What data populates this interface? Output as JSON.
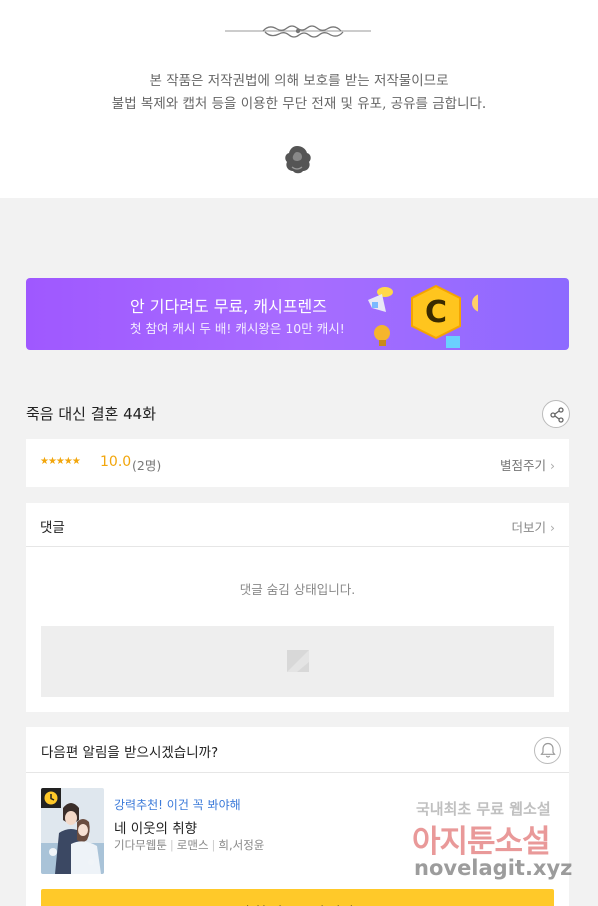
{
  "copyright": {
    "line1": "본 작품은 저작권법에 의해 보호를 받는 저작물이므로",
    "line2": "불법 복제와 캡처 등을 이용한 무단 전재 및 유포, 공유를 금합니다."
  },
  "banner": {
    "title": "안 기다려도 무료, 캐시프렌즈",
    "subtitle": "첫 참여 캐시 두 배! 캐시왕은 10만 캐시!",
    "accent": "#a066ff"
  },
  "episode": {
    "title": "죽음 대신 결혼 44화"
  },
  "rating": {
    "stars": "★★★★★",
    "score": "10.0",
    "count": "(2명)",
    "rate_label": "별점주기"
  },
  "comments": {
    "title": "댓글",
    "more_label": "더보기",
    "hidden_message": "댓글 숨김 상태입니다."
  },
  "next_episode": {
    "question": "다음편 알림을 받으시겠습니까?",
    "recommend_tag": "강력추천! 이건 꼭 봐야해",
    "recommend_title": "네 이웃의 취향",
    "meta": [
      "기다무웹툰",
      "로맨스",
      "희,서정윤"
    ],
    "cta_label": "추천 작품 보러 가기"
  },
  "watermark": {
    "line1": "국내최초 무료 웹소설",
    "line2": "아지툰소설",
    "line3": "novelagit.xyz"
  },
  "colors": {
    "star": "#f2a60c",
    "link_blue": "#3b7ad9",
    "cta_yellow": "#ffc929"
  }
}
